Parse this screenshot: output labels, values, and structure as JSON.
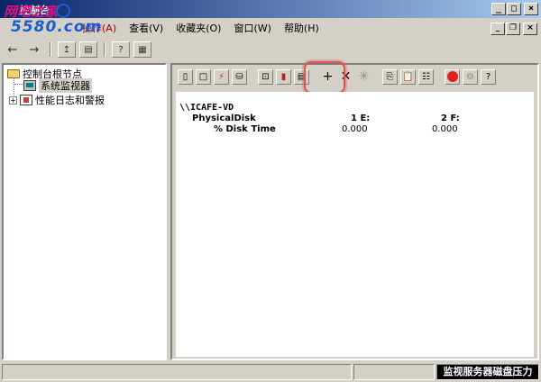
{
  "window": {
    "title": "控制台"
  },
  "watermark": {
    "line1": "网吧之家",
    "line2": "5580.com"
  },
  "menu": {
    "file": "文件(F)",
    "action": "操作(A)",
    "view": "查看(V)",
    "favorites": "收藏夹(O)",
    "window": "窗口(W)",
    "help": "帮助(H)"
  },
  "tree": {
    "root": "控制台根节点",
    "monitor": "系统监视器",
    "logs": "性能日志和警报"
  },
  "report": {
    "host": "\\\\ICAFE-VD",
    "object": "PhysicalDisk",
    "counter": "% Disk Time",
    "instances": [
      "1 E:",
      "2 F:"
    ],
    "values": [
      "0.000",
      "0.000"
    ]
  },
  "status": {
    "caption": "监视服务器磁盘压力"
  }
}
